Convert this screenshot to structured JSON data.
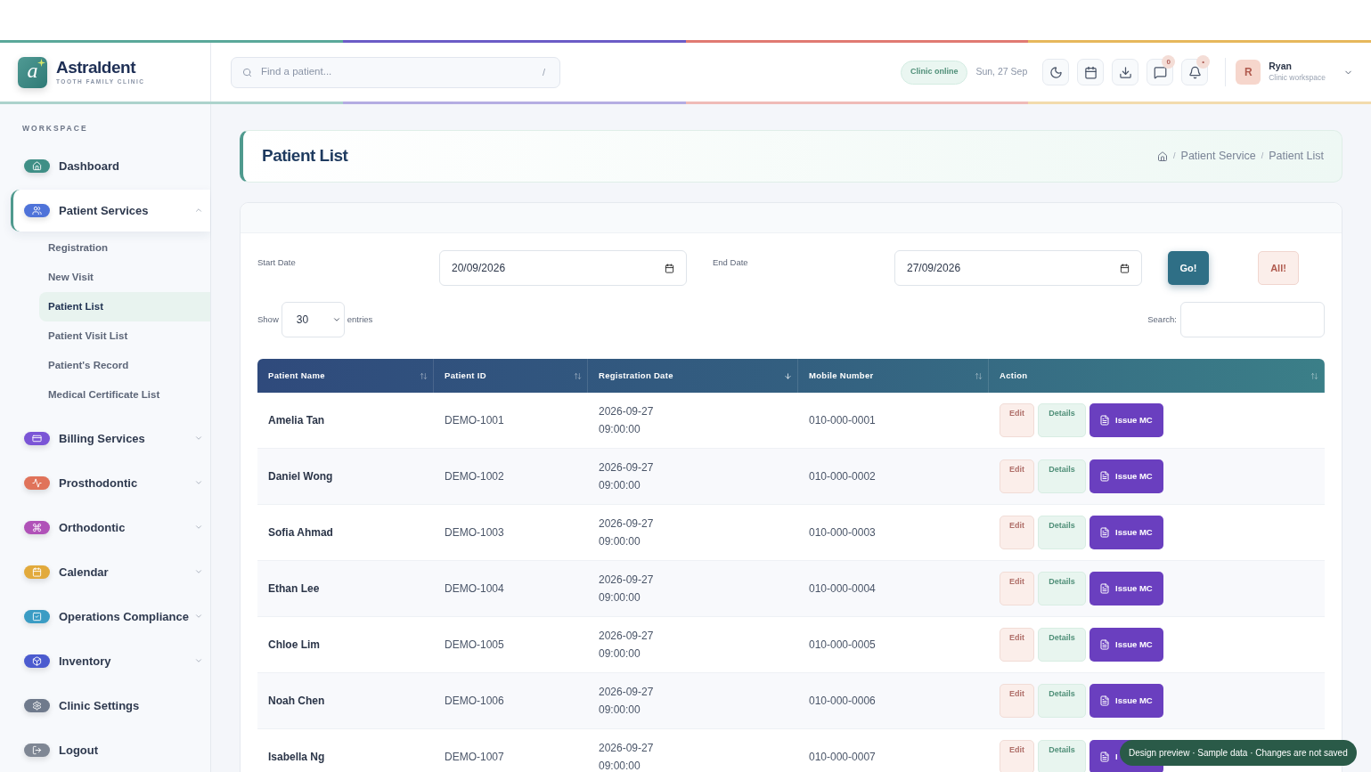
{
  "brand": {
    "name": "Astraldent",
    "tagline": "TOOTH FAMILY CLINIC",
    "logo_letter": "a"
  },
  "search": {
    "placeholder": "Find a patient...",
    "shortcut": "/"
  },
  "status": "Clinic online",
  "date": "Sun, 27 Sep",
  "toolbar": [
    {
      "kind": "theme"
    },
    {
      "kind": "calendar"
    },
    {
      "kind": "download"
    },
    {
      "kind": "messages",
      "badge": "0"
    },
    {
      "kind": "notifications",
      "badge": "•"
    }
  ],
  "user": {
    "initial": "R",
    "name": "Ryan",
    "role": "Clinic workspace"
  },
  "sidebar": {
    "section": "WORKSPACE",
    "items": [
      {
        "label": "Dashboard",
        "color": "#3f8f86",
        "selected": false
      },
      {
        "label": "Patient Services",
        "color": "#4f73d9",
        "selected": true,
        "expanded": true,
        "children": [
          {
            "label": "Registration",
            "selected": false
          },
          {
            "label": "New Visit",
            "selected": false
          },
          {
            "label": "Patient List",
            "selected": true
          },
          {
            "label": "Patient Visit List",
            "selected": false
          },
          {
            "label": "Patient's Record",
            "selected": false
          },
          {
            "label": "Medical Certificate List",
            "selected": false
          }
        ]
      },
      {
        "label": "Billing Services",
        "color": "#7b55d6",
        "selected": false,
        "expanded": false
      },
      {
        "label": "Prosthodontic",
        "color": "#e0735a",
        "selected": false,
        "expanded": false
      },
      {
        "label": "Orthodontic",
        "color": "#b052b8",
        "selected": false,
        "expanded": false
      },
      {
        "label": "Calendar",
        "color": "#e2aa3c",
        "selected": false,
        "expanded": false
      },
      {
        "label": "Operations Compliance",
        "color": "#3a9cc4",
        "selected": false,
        "expanded": false
      },
      {
        "label": "Inventory",
        "color": "#4b5bcf",
        "selected": false,
        "expanded": false
      },
      {
        "label": "Clinic Settings",
        "color": "#6f7a8c",
        "selected": false
      },
      {
        "label": "Logout",
        "color": "#7f8794",
        "selected": false
      }
    ]
  },
  "page": {
    "title": "Patient List",
    "separator": "/",
    "breadcrumb": [
      "Patient Service",
      "Patient List"
    ]
  },
  "filters": {
    "start_label": "Start Date",
    "start_value": "20/09/2026",
    "end_label": "End Date",
    "end_value": "27/09/2026",
    "go": "Go!",
    "all": "All!"
  },
  "entries": {
    "show": "Show",
    "value": "30",
    "suffix": "entries",
    "search_label": "Search:"
  },
  "table": {
    "columns": [
      {
        "label": "Patient Name",
        "sorted": false
      },
      {
        "label": "Patient ID",
        "sorted": false
      },
      {
        "label": "Registration Date",
        "sorted": true
      },
      {
        "label": "Mobile Number",
        "sorted": false
      },
      {
        "label": "Action",
        "sorted": false
      }
    ],
    "rows": [
      {
        "name": "Amelia Tan",
        "id": "DEMO-1001",
        "date": "2026-09-27",
        "time": "09:00:00",
        "mobile": "010-000-0001",
        "edit": "Edit",
        "details": "Details",
        "issue": "Issue MC"
      },
      {
        "name": "Daniel Wong",
        "id": "DEMO-1002",
        "date": "2026-09-27",
        "time": "09:00:00",
        "mobile": "010-000-0002",
        "edit": "Edit",
        "details": "Details",
        "issue": "Issue MC"
      },
      {
        "name": "Sofia Ahmad",
        "id": "DEMO-1003",
        "date": "2026-09-27",
        "time": "09:00:00",
        "mobile": "010-000-0003",
        "edit": "Edit",
        "details": "Details",
        "issue": "Issue MC"
      },
      {
        "name": "Ethan Lee",
        "id": "DEMO-1004",
        "date": "2026-09-27",
        "time": "09:00:00",
        "mobile": "010-000-0004",
        "edit": "Edit",
        "details": "Details",
        "issue": "Issue MC"
      },
      {
        "name": "Chloe Lim",
        "id": "DEMO-1005",
        "date": "2026-09-27",
        "time": "09:00:00",
        "mobile": "010-000-0005",
        "edit": "Edit",
        "details": "Details",
        "issue": "Issue MC"
      },
      {
        "name": "Noah Chen",
        "id": "DEMO-1006",
        "date": "2026-09-27",
        "time": "09:00:00",
        "mobile": "010-000-0006",
        "edit": "Edit",
        "details": "Details",
        "issue": "Issue MC"
      },
      {
        "name": "Isabella Ng",
        "id": "DEMO-1007",
        "date": "2026-09-27",
        "time": "09:00:00",
        "mobile": "010-000-0007",
        "edit": "Edit",
        "details": "Details",
        "issue": "I"
      }
    ]
  },
  "toast": "Design preview · Sample data · Changes are not saved"
}
